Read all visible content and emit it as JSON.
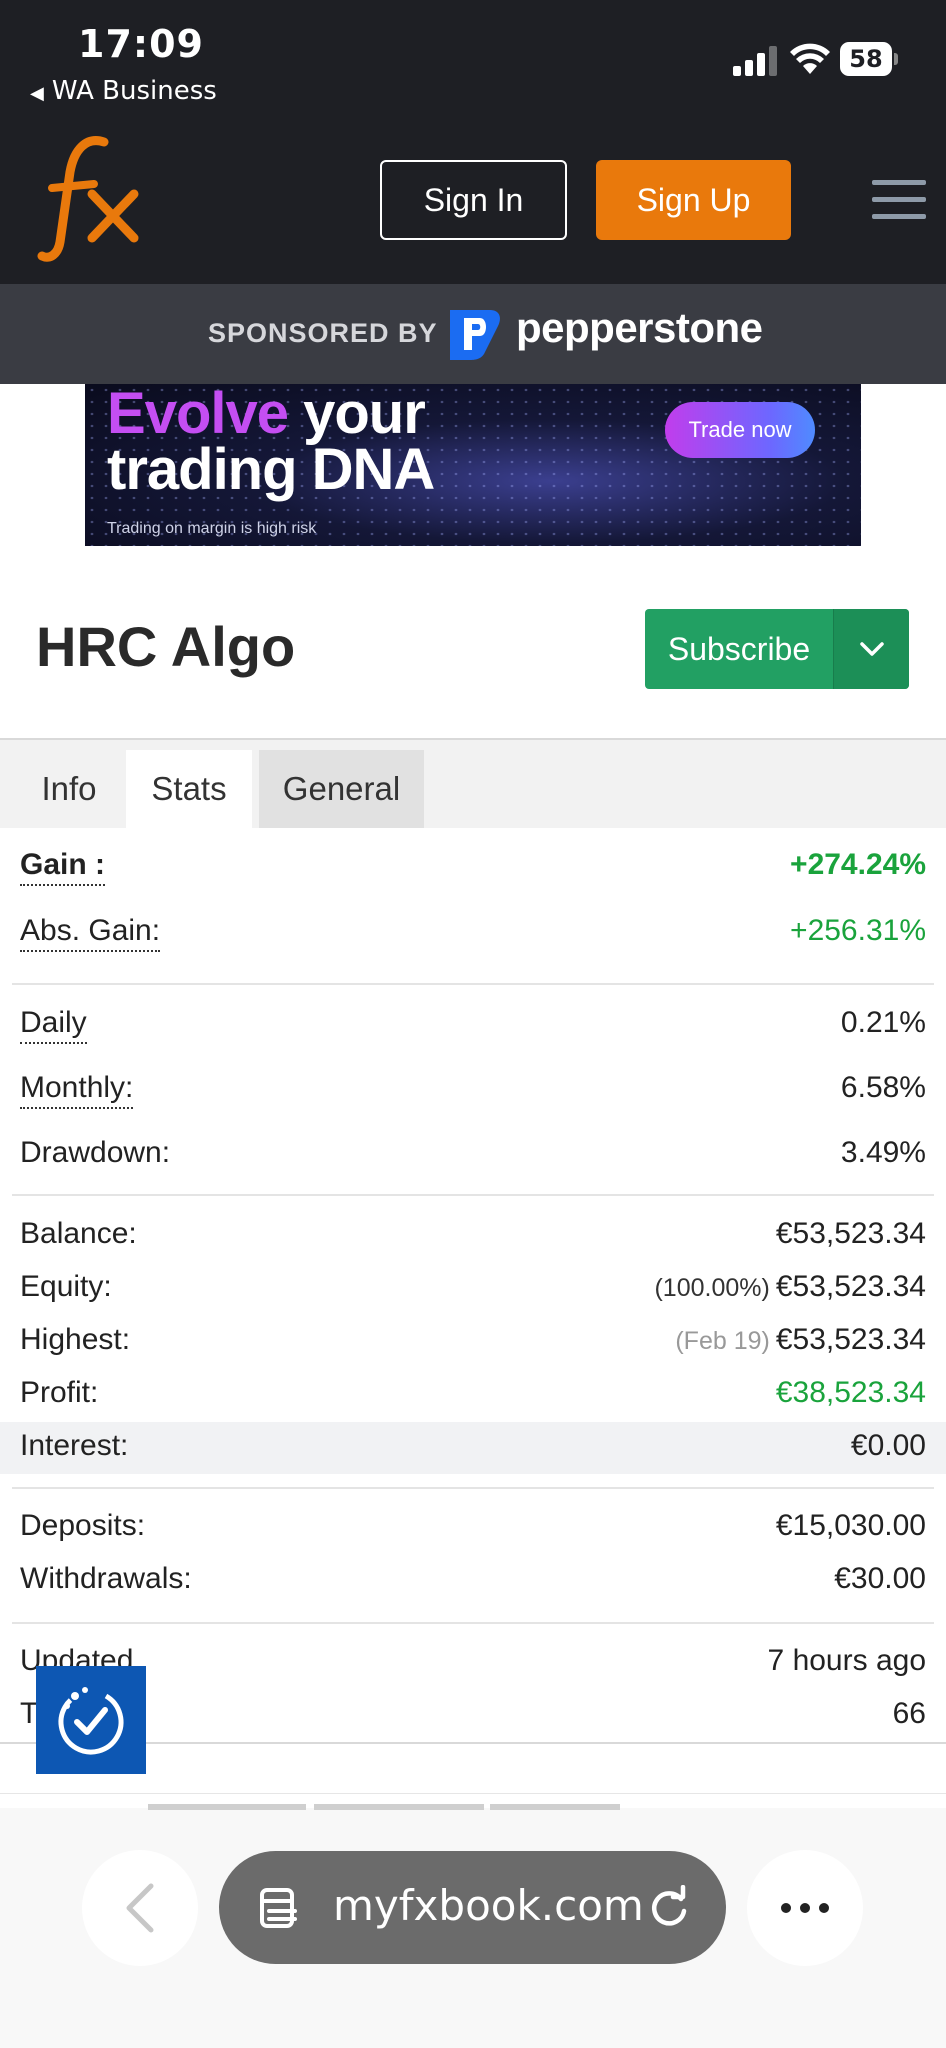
{
  "status_bar": {
    "time": "17:09",
    "back_app": "WA Business",
    "battery": "58"
  },
  "header": {
    "logo_text": "fx",
    "sign_in": "Sign In",
    "sign_up": "Sign Up"
  },
  "sponsor": {
    "label": "SPONSORED BY",
    "brand": "pepperstone"
  },
  "ad": {
    "word_highlight": "Evolve",
    "line1_rest": " your",
    "line2": "trading DNA",
    "cta": "Trade now",
    "disclaimer": "Trading on margin is high risk"
  },
  "page": {
    "title": "HRC Algo",
    "subscribe": "Subscribe"
  },
  "tabs": [
    "Info",
    "Stats",
    "General"
  ],
  "stats": {
    "gain_label": "Gain :",
    "gain_value": "+274.24%",
    "abs_gain_label": "Abs. Gain:",
    "abs_gain_value": "+256.31%",
    "daily_label": "Daily",
    "daily_value": "0.21%",
    "monthly_label": "Monthly:",
    "monthly_value": "6.58%",
    "drawdown_label": "Drawdown:",
    "drawdown_value": "3.49%",
    "balance_label": "Balance:",
    "balance_value": "€53,523.34",
    "equity_label": "Equity:",
    "equity_pct": "(100.00%)",
    "equity_value": "€53,523.34",
    "highest_label": "Highest:",
    "highest_date": "(Feb 19)",
    "highest_value": "€53,523.34",
    "profit_label": "Profit:",
    "profit_value": "€38,523.34",
    "interest_label": "Interest:",
    "interest_value": "€0.00",
    "deposits_label": "Deposits:",
    "deposits_value": "€15,030.00",
    "withdrawals_label": "Withdrawals:",
    "withdrawals_value": "€30.00",
    "updated_label": "Updated",
    "updated_value": "7 hours ago",
    "tracking_label": "T",
    "tracking_value": "66"
  },
  "browser": {
    "url": "myfxbook.com"
  },
  "colors": {
    "accent_orange": "#e9790c",
    "subscribe_green": "#22a063",
    "positive_green": "#1aa33c",
    "header_dark": "#1e1f24"
  }
}
